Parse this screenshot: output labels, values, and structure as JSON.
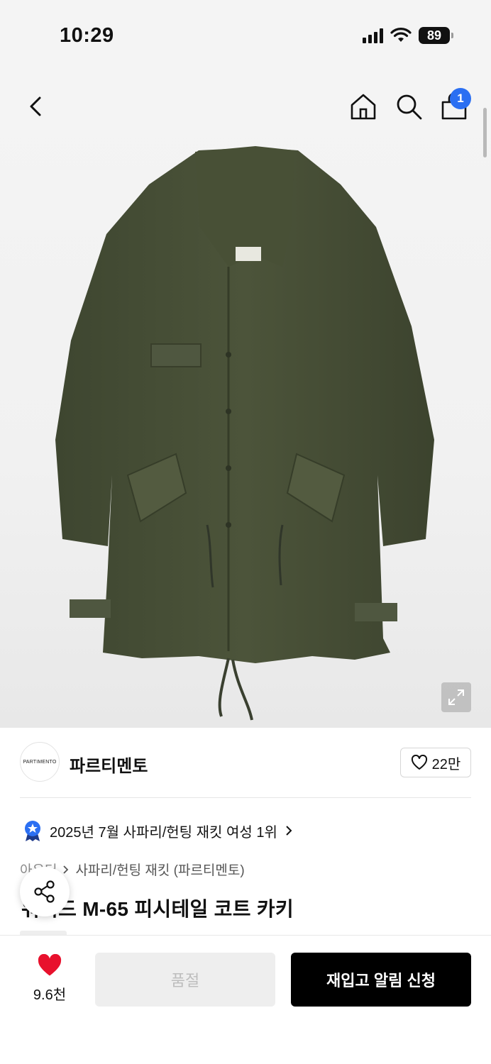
{
  "status_bar": {
    "time": "10:29",
    "battery": "89"
  },
  "header": {
    "cart_count": "1"
  },
  "brand": {
    "logo_text": "PARTIMENTO",
    "name": "파르티멘토",
    "likes": "22만"
  },
  "ranking": {
    "text": "2025년 7월 사파리/헌팅 재킷 여성 1위"
  },
  "breadcrumb": {
    "first": "아우터",
    "second": "사파리/헌팅 재킷 (파르티멘토)"
  },
  "product": {
    "title": "워시드 M-65 피시테일 코트 카키"
  },
  "bottom_bar": {
    "wish_count": "9.6천",
    "soldout_label": "품절",
    "restock_label": "재입고 알림 신청"
  },
  "colors": {
    "accent_blue": "#2b6ff2",
    "heart_red": "#e8112d",
    "coat_green": "#4a5236"
  }
}
